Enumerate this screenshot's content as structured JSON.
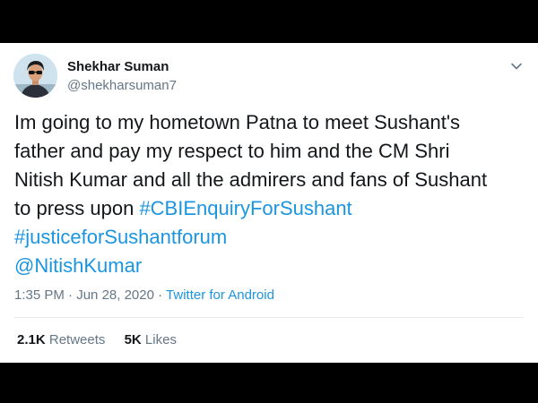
{
  "user": {
    "name": "Shekhar Suman",
    "handle": "@shekharsuman7"
  },
  "tweet": {
    "text_line1": "Im going to my hometown Patna to meet Sushant's",
    "text_line2": "father and pay my respect to him and the CM Shri",
    "text_line3": "Nitish Kumar and all the admirers and fans of Sushant",
    "text_line4_prefix": "to press upon ",
    "hashtag1": "#CBIEnquiryForSushant",
    "hashtag2": "#justiceforSushantforum",
    "mention": "@NitishKumar"
  },
  "meta": {
    "time": "1:35 PM",
    "sep1": " · ",
    "date": "Jun 28, 2020",
    "sep2": " · ",
    "source": "Twitter for Android"
  },
  "stats": {
    "retweets_count": "2.1K",
    "retweets_label": "Retweets",
    "likes_count": "5K",
    "likes_label": "Likes"
  },
  "colors": {
    "link": "#1b95e0",
    "text": "#14171a",
    "muted": "#657786",
    "letterbox": "#000000"
  },
  "icons": {
    "caret": "chevron-down-icon",
    "avatar": "avatar"
  }
}
